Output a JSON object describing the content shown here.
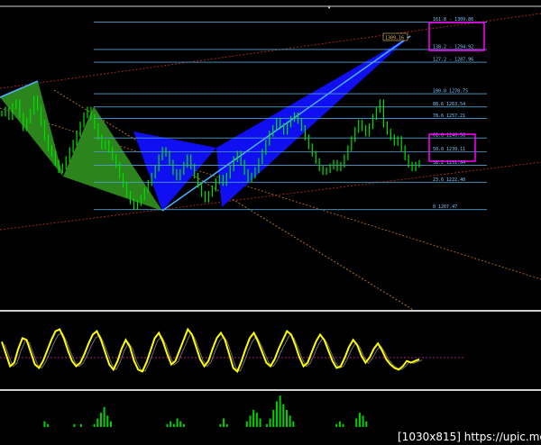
{
  "watermark": "[1030x815] https://upic.me/",
  "price_tag": "1309.16",
  "colors": {
    "background": "#000000",
    "candles": "#00e000",
    "pattern_green": "#2e8b1e",
    "pattern_blue": "#1010ff",
    "fib_lines": "#4f9fd0",
    "channel": "#c04020",
    "oscillator": "#ffff00",
    "volume_bars": "#00d000",
    "highlight_box": "#ff00ff"
  },
  "chart_data": [
    {
      "type": "line",
      "fib_levels": [
        {
          "ratio": "161.8",
          "price": 1309.86,
          "label": "161.8 - 1309.86"
        },
        {
          "ratio": "138.2",
          "price": 1294.92,
          "label": "138.2 - 1294.92"
        },
        {
          "ratio": "127.2",
          "price": 1287.96,
          "label": "127.2 - 1287.96"
        },
        {
          "ratio": "100.0",
          "price": 1270.75,
          "label": "100.0 1270.75"
        },
        {
          "ratio": "88.6",
          "price": 1263.54,
          "label": "88.6 1263.54"
        },
        {
          "ratio": "78.6",
          "price": 1257.21,
          "label": "78.6 1257.21"
        },
        {
          "ratio": "61.8",
          "price": 1246.58,
          "label": "61.8 1246.58"
        },
        {
          "ratio": "50.0",
          "price": 1239.11,
          "label": "50.0 1239.11"
        },
        {
          "ratio": "38.2",
          "price": 1231.64,
          "label": "38.2 1231.64"
        },
        {
          "ratio": "23.6",
          "price": 1222.4,
          "label": "23.6 1222.40"
        },
        {
          "ratio": "0",
          "price": 1207.47,
          "label": "0 1207.47"
        }
      ],
      "highlighted_levels": [
        "161.8",
        "61.8"
      ],
      "price_series": [
        1260,
        1262,
        1258,
        1264,
        1266,
        1259,
        1252,
        1256,
        1261,
        1268,
        1263,
        1255,
        1247,
        1241,
        1238,
        1233,
        1229,
        1231,
        1235,
        1240,
        1244,
        1249,
        1254,
        1259,
        1262,
        1258,
        1253,
        1247,
        1242,
        1244,
        1240,
        1236,
        1232,
        1226,
        1221,
        1216,
        1212,
        1209,
        1211,
        1214,
        1218,
        1222,
        1226,
        1230,
        1236,
        1240,
        1238,
        1233,
        1228,
        1225,
        1228,
        1232,
        1236,
        1231,
        1226,
        1221,
        1216,
        1213,
        1216,
        1219,
        1223,
        1225,
        1222,
        1226,
        1230,
        1235,
        1238,
        1233,
        1228,
        1224,
        1226,
        1229,
        1234,
        1239,
        1244,
        1249,
        1252,
        1256,
        1253,
        1250,
        1254,
        1257,
        1259,
        1256,
        1252,
        1247,
        1242,
        1238,
        1234,
        1230,
        1228,
        1229,
        1231,
        1233,
        1230,
        1232,
        1236,
        1241,
        1246,
        1251,
        1255,
        1252,
        1249,
        1253,
        1258,
        1262,
        1266,
        1254,
        1250,
        1247,
        1244,
        1246,
        1241,
        1236,
        1232,
        1230,
        1232,
        1233
      ],
      "ylim": [
        1196,
        1318
      ]
    },
    {
      "type": "line",
      "series": [
        {
          "values": [
            0.25,
            -0.1,
            -0.45,
            -0.35,
            0.05,
            0.35,
            0.3,
            -0.05,
            -0.4,
            -0.5,
            -0.3,
            0.0,
            0.3,
            0.55,
            0.6,
            0.35,
            0.0,
            -0.3,
            -0.45,
            -0.35,
            -0.1,
            0.2,
            0.45,
            0.55,
            0.3,
            -0.05,
            -0.4,
            -0.55,
            -0.3,
            0.05,
            0.3,
            0.1,
            -0.3,
            -0.55,
            -0.6,
            -0.35,
            0.0,
            0.35,
            0.5,
            0.25,
            -0.1,
            -0.4,
            -0.3,
            0.0,
            0.3,
            0.6,
            0.45,
            0.1,
            -0.25,
            -0.45,
            -0.3,
            0.05,
            0.35,
            0.5,
            0.3,
            -0.1,
            -0.5,
            -0.6,
            -0.3,
            0.05,
            0.35,
            0.5,
            0.25,
            -0.05,
            -0.35,
            -0.45,
            -0.25,
            0.05,
            0.3,
            0.55,
            0.45,
            0.15,
            -0.2,
            -0.45,
            -0.35,
            -0.05,
            0.25,
            0.45,
            0.3,
            0.0,
            -0.3,
            -0.5,
            -0.45,
            -0.2,
            0.1,
            0.3,
            0.15,
            -0.15,
            -0.35,
            -0.2,
            0.05,
            0.2,
            0.0,
            -0.25,
            -0.4,
            -0.5,
            -0.55,
            -0.45,
            -0.3,
            -0.35,
            -0.3,
            -0.25
          ]
        }
      ],
      "ylim": [
        -1,
        1
      ]
    },
    {
      "type": "bar",
      "values": [
        0,
        0,
        0,
        0,
        0,
        2,
        1,
        0,
        0,
        0,
        0,
        0,
        0,
        0,
        1,
        0,
        1,
        0,
        0,
        0,
        1,
        3,
        5,
        7,
        4,
        2,
        0,
        0,
        0,
        0,
        0,
        0,
        0,
        0,
        0,
        0,
        0,
        0,
        0,
        0,
        0,
        0,
        1,
        2,
        1,
        3,
        2,
        1,
        0,
        0,
        0,
        0,
        0,
        0,
        0,
        0,
        0,
        0,
        1,
        3,
        1,
        0,
        0,
        0,
        0,
        0,
        2,
        4,
        6,
        5,
        3,
        0,
        1,
        3,
        6,
        9,
        11,
        8,
        6,
        4,
        2,
        0,
        0,
        0,
        0,
        0,
        0,
        0,
        0,
        0,
        0,
        0,
        0,
        1,
        2,
        1,
        0,
        0,
        0,
        3,
        5,
        4,
        2,
        0,
        0,
        0,
        0
      ],
      "ylim": [
        0,
        12
      ]
    }
  ]
}
